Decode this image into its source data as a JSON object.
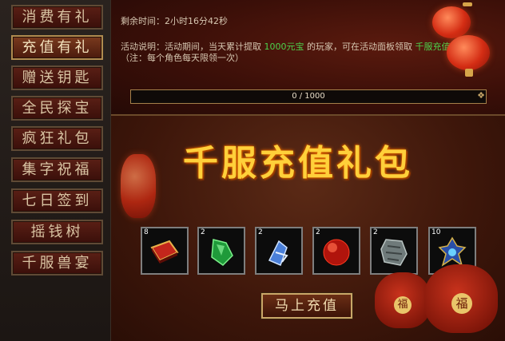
{
  "sidebar": {
    "items": [
      {
        "label": "消费有礼",
        "active": false
      },
      {
        "label": "充值有礼",
        "active": true
      },
      {
        "label": "赠送钥匙",
        "active": false
      },
      {
        "label": "全民探宝",
        "active": false
      },
      {
        "label": "疯狂礼包",
        "active": false
      },
      {
        "label": "集字祝福",
        "active": false
      },
      {
        "label": "七日签到",
        "active": false
      },
      {
        "label": "摇钱树",
        "active": false
      },
      {
        "label": "千服兽宴",
        "active": false
      }
    ]
  },
  "event": {
    "time_label": "剩余时间：",
    "time_value": "2小时16分42秒",
    "desc_prefix": "活动说明：活动期间，当天累计提取",
    "desc_amount": "1000元宝",
    "desc_middle": "的玩家，可在活动面板领取",
    "desc_reward": "千服充值礼包",
    "note": "（注：每个角色每天限领一次）"
  },
  "progress": {
    "text": "0 / 1000",
    "current": 0,
    "total": 1000
  },
  "banner": {
    "title": "千服充值礼包"
  },
  "rewards": [
    {
      "count": "8",
      "icon": "red-book-icon"
    },
    {
      "count": "2",
      "icon": "green-gem-icon"
    },
    {
      "count": "2",
      "icon": "blue-crystal-icon"
    },
    {
      "count": "2",
      "icon": "red-orb-icon"
    },
    {
      "count": "2",
      "icon": "stone-tablet-icon"
    },
    {
      "count": "10",
      "icon": "blue-ornament-icon"
    }
  ],
  "actions": {
    "recharge_label": "马上充值"
  },
  "decor": {
    "fu_char": "福"
  },
  "colors": {
    "accent_gold": "#ffd03a",
    "highlight_green": "#4cd14c",
    "panel_red": "#3b0f08",
    "border_gold": "#c9a768"
  }
}
